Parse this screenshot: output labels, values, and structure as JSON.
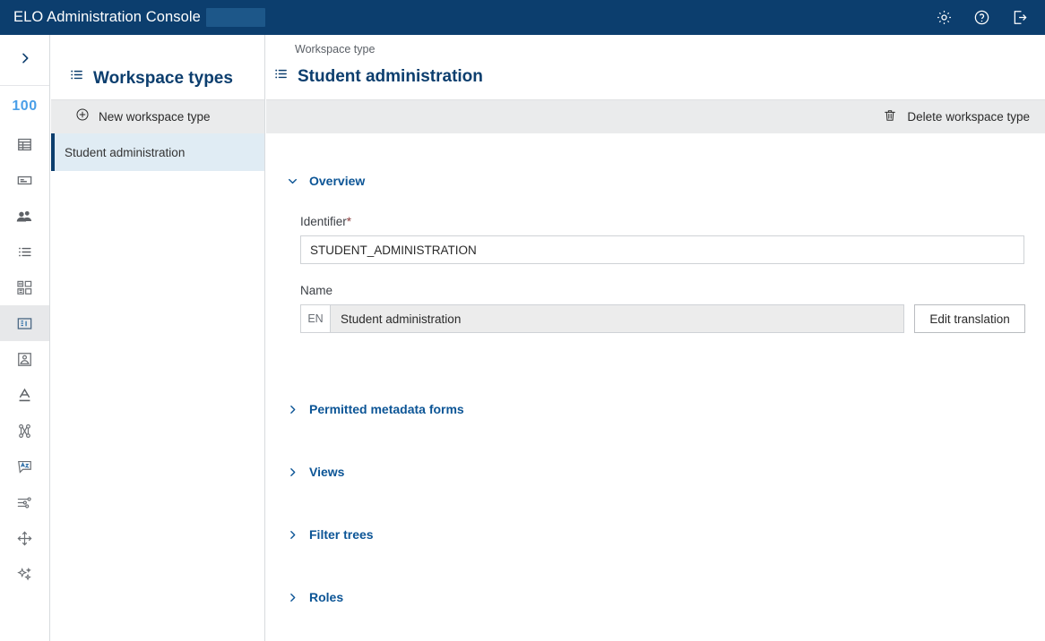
{
  "topbar": {
    "app_title": "ELO Administration Console",
    "redacted": true,
    "actions": [
      {
        "name": "settings-button",
        "icon": "gear-icon"
      },
      {
        "name": "help-button",
        "icon": "question-circle-icon"
      },
      {
        "name": "logout-button",
        "icon": "logout-icon"
      }
    ],
    "colors": {
      "background": "#0c3e6e",
      "redaction": "#1d5789"
    }
  },
  "rail": {
    "toggle_icon": "chevron-right-icon",
    "badge": "100",
    "badge_color": "#4a9fe8",
    "items": [
      {
        "icon": "table-icon",
        "selected": false
      },
      {
        "icon": "card-icon",
        "selected": false
      },
      {
        "icon": "users-icon",
        "selected": false
      },
      {
        "icon": "list-icon",
        "selected": false
      },
      {
        "icon": "modules-icon",
        "selected": false
      },
      {
        "icon": "workspace-types-icon",
        "selected": true
      },
      {
        "icon": "image-placeholder-icon",
        "selected": false
      },
      {
        "icon": "text-format-icon",
        "selected": false
      },
      {
        "icon": "hierarchy-icon",
        "selected": false
      },
      {
        "icon": "translation-icon",
        "selected": false
      },
      {
        "icon": "sliders-icon",
        "selected": false
      },
      {
        "icon": "move-icon",
        "selected": false
      },
      {
        "icon": "sparkle-icon",
        "selected": false
      }
    ]
  },
  "list_panel": {
    "icon": "list-icon",
    "title": "Workspace types",
    "new_button": {
      "icon": "plus-circle-icon",
      "label": "New workspace type"
    },
    "rows": [
      {
        "label": "Student administration",
        "selected": true
      }
    ]
  },
  "main": {
    "breadcrumb": "Workspace type",
    "title_icon": "list-icon",
    "title": "Student administration",
    "toolbar": {
      "delete_icon": "trash-icon",
      "delete_label": "Delete workspace type"
    },
    "overview": {
      "caret": "chevron-down-icon",
      "title": "Overview",
      "identifier": {
        "label": "Identifier",
        "required_marker": "*",
        "value": "STUDENT_ADMINISTRATION",
        "placeholder": ""
      },
      "name": {
        "label": "Name",
        "language": "EN",
        "value": "Student administration",
        "edit_translation_label": "Edit translation"
      }
    },
    "sections": [
      {
        "caret": "chevron-right-icon",
        "title": "Permitted metadata forms"
      },
      {
        "caret": "chevron-right-icon",
        "title": "Views"
      },
      {
        "caret": "chevron-right-icon",
        "title": "Filter trees"
      },
      {
        "caret": "chevron-right-icon",
        "title": "Roles"
      }
    ]
  },
  "colors": {
    "brand_dark_blue": "#0c3e6e",
    "section_blue": "#0c5596",
    "toolbar_gray": "#eaebec",
    "selected_row": "#e0ecf4"
  }
}
